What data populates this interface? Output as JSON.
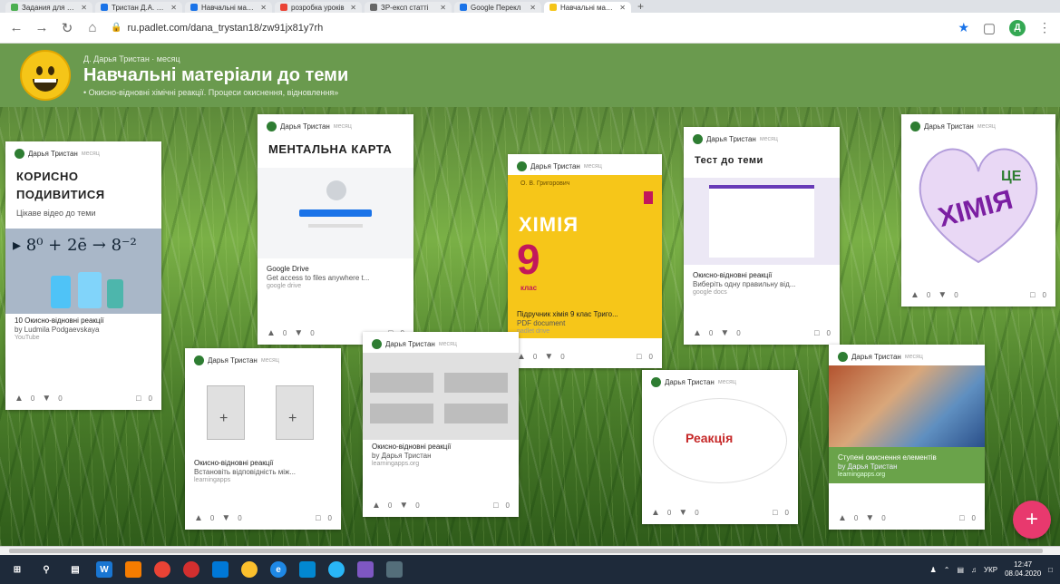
{
  "browser": {
    "tabs": [
      {
        "label": "Задания для суп",
        "color": "#4caf50",
        "active": false
      },
      {
        "label": "Тристан Д.А. Тест",
        "color": "#1a73e8",
        "active": false
      },
      {
        "label": "Навчальні матер",
        "color": "#1a73e8",
        "active": false
      },
      {
        "label": "розробка уроків",
        "color": "#ea4335",
        "active": false
      },
      {
        "label": "ЗР-експ статті",
        "color": "#666666",
        "active": false
      },
      {
        "label": "Google Перекл",
        "color": "#1a73e8",
        "active": false
      },
      {
        "label": "Навчальні матер",
        "color": "#f5c518",
        "active": true
      }
    ],
    "url": "ru.padlet.com/dana_trystan18/zw91jx81y7rh",
    "profile_initial": "Д"
  },
  "header": {
    "author_line": "Д. Дарья Тристан · месяц",
    "title": "Навчальні матеріали до теми",
    "subtitle": "• Окисно-відновні хімічні реакції. Процеси окиснення, відновлення»"
  },
  "cards": [
    {
      "author": "Дарья Тристан",
      "meta": "месяц",
      "title": "КОРИСНО ПОДИВИТИСЯ",
      "text": "Цікаве відео до теми",
      "att_title": "10 Окисно-відновні реакції",
      "att_desc": "by Ludmila Podgaevskaya",
      "att_src": "YouTube",
      "likes": "0",
      "dislikes": "0",
      "comments": "0"
    },
    {
      "author": "Дарья Тристан",
      "meta": "месяц",
      "title": "МЕНТАЛЬНА КАРТА",
      "att_title": "Google Drive",
      "att_desc": "Get access to files anywhere t...",
      "att_src": "google drive",
      "likes": "0",
      "dislikes": "0",
      "comments": "0"
    },
    {
      "author": "Дарья Тристан",
      "meta": "месяц",
      "book_author": "О. В. Григорович",
      "book_title": "ХІМІЯ",
      "book_grade": "9",
      "book_class": "клас",
      "att_title": "Підручник хімія 9 клас Триго...",
      "att_desc": "PDF document",
      "att_src": "padlet drive",
      "likes": "0",
      "dislikes": "0",
      "comments": "0"
    },
    {
      "author": "Дарья Тристан",
      "meta": "месяц",
      "title": "Тест до теми",
      "att_title": "Окисно-відновні реакції",
      "att_desc": "Виберіть одну правильну від...",
      "att_src": "google docs",
      "likes": "0",
      "dislikes": "0",
      "comments": "0"
    },
    {
      "author": "Дарья Тристан",
      "meta": "месяц",
      "cloud_word": "ХІМІЯ",
      "cloud_word2": "ЦЕ",
      "likes": "0",
      "dislikes": "0",
      "comments": "0"
    },
    {
      "author": "Дарья Тристан",
      "meta": "месяц",
      "att_title": "Окисно-відновні реакції",
      "att_desc": "Встановіть відповідність між...",
      "att_src": "learningapps",
      "likes": "0",
      "dislikes": "0",
      "comments": "0"
    },
    {
      "author": "Дарья Тристан",
      "meta": "месяц",
      "att_title": "Окисно-відновні реакції",
      "att_desc": "by Дарья Тристан",
      "att_src": "learningapps.org",
      "likes": "0",
      "dislikes": "0",
      "comments": "0"
    },
    {
      "author": "Дарья Тристан",
      "meta": "месяц",
      "cloud_word": "Реакція",
      "att_title": "",
      "likes": "0",
      "dislikes": "0",
      "comments": "0"
    },
    {
      "author": "Дарья Тристан",
      "meta": "месяц",
      "att_title": "Ступені окиснення елементів",
      "att_desc": "by Дарья Тристан",
      "att_src": "learningapps.org",
      "likes": "0",
      "dislikes": "0",
      "comments": "0"
    }
  ],
  "fab_label": "+",
  "taskbar": {
    "lang": "УКР",
    "time": "12:47",
    "date": "08.04.2020"
  }
}
